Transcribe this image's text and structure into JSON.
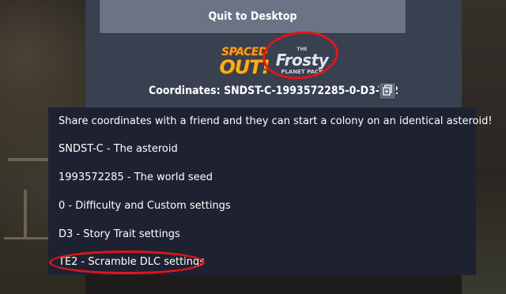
{
  "menu": {
    "quit_label": "Quit to Desktop"
  },
  "logos": {
    "spaced_out": {
      "line1": "SPACED",
      "line2": "OUT!"
    },
    "frosty": {
      "top": "THE",
      "title": "Frosty",
      "bottom": "PLANET PACK"
    }
  },
  "coordinates": {
    "label": "Coordinates:",
    "value": "SNDST-C-1993572285-0-D3-TE2",
    "copy_icon": "copy-icon"
  },
  "tooltip": {
    "intro": "Share coordinates with a friend and they can start a colony on an identical asteroid!",
    "lines": [
      "SNDST-C - The asteroid",
      "1993572285 - The world seed",
      "0 - Difficulty and Custom settings",
      "D3 - Story Trait settings",
      "TE2 - Scramble DLC settings"
    ]
  },
  "colors": {
    "panel_bg": "#39404f",
    "button_bg": "#6b7385",
    "tooltip_bg": "#1e2230",
    "annotation_red": "#e0151b",
    "spaced_out_orange": "#f7a01f"
  }
}
